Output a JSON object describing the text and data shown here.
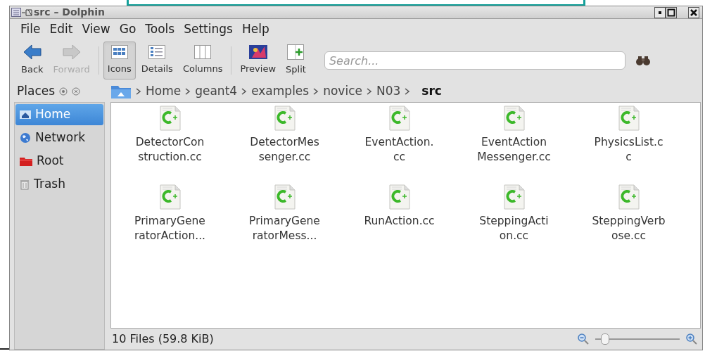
{
  "window": {
    "title": "src – Dolphin"
  },
  "menu": [
    "File",
    "Edit",
    "View",
    "Go",
    "Tools",
    "Settings",
    "Help"
  ],
  "toolbar": [
    {
      "label": "Back",
      "kind": "back",
      "disabled": false,
      "selected": false
    },
    {
      "label": "Forward",
      "kind": "forward",
      "disabled": true,
      "selected": false
    },
    {
      "label": "Icons",
      "kind": "icons",
      "disabled": false,
      "selected": true
    },
    {
      "label": "Details",
      "kind": "details",
      "disabled": false,
      "selected": false
    },
    {
      "label": "Columns",
      "kind": "columns",
      "disabled": false,
      "selected": false
    },
    {
      "label": "Preview",
      "kind": "preview",
      "disabled": false,
      "selected": false
    },
    {
      "label": "Split",
      "kind": "split",
      "disabled": false,
      "selected": false
    }
  ],
  "search": {
    "placeholder": "Search..."
  },
  "places": {
    "title": "Places",
    "items": [
      {
        "label": "Home",
        "kind": "home",
        "selected": true
      },
      {
        "label": "Network",
        "kind": "network",
        "selected": false
      },
      {
        "label": "Root",
        "kind": "root",
        "selected": false
      },
      {
        "label": "Trash",
        "kind": "trash",
        "selected": false
      }
    ]
  },
  "breadcrumb": [
    "Home",
    "geant4",
    "examples",
    "novice",
    "N03",
    "src"
  ],
  "files": [
    {
      "lines": [
        "DetectorCon",
        "struction.cc"
      ]
    },
    {
      "lines": [
        "DetectorMes",
        "senger.cc"
      ]
    },
    {
      "lines": [
        "EventAction.",
        "cc"
      ]
    },
    {
      "lines": [
        "EventAction",
        "Messenger.cc"
      ]
    },
    {
      "lines": [
        "PhysicsList.c",
        "c"
      ]
    },
    {
      "lines": [
        "PrimaryGene",
        "ratorAction..."
      ]
    },
    {
      "lines": [
        "PrimaryGene",
        "ratorMess..."
      ]
    },
    {
      "lines": [
        "RunAction.cc"
      ]
    },
    {
      "lines": [
        "SteppingActi",
        "on.cc"
      ]
    },
    {
      "lines": [
        "SteppingVerb",
        "ose.cc"
      ]
    }
  ],
  "status_bar": {
    "text": "10 Files (59.8 KiB)",
    "zoom": {
      "level": 0.12
    }
  }
}
